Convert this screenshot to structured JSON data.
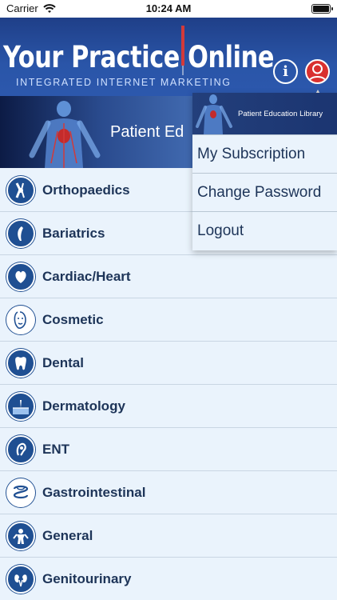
{
  "status_bar": {
    "carrier": "Carrier",
    "time": "10:24 AM"
  },
  "header": {
    "logo_title": "Your Practice Online",
    "logo_subtitle": "INTEGRATED INTERNET MARKETING",
    "info_icon": "info-icon",
    "user_icon": "user-icon"
  },
  "banner": {
    "label": "Patient Ed"
  },
  "menu": {
    "banner_label": "Patient Education Library",
    "items": [
      {
        "label": "My Subscription"
      },
      {
        "label": "Change Password"
      },
      {
        "label": "Logout"
      }
    ]
  },
  "categories": [
    {
      "label": "Orthopaedics",
      "icon": "knee-joint-icon"
    },
    {
      "label": "Bariatrics",
      "icon": "stomach-icon"
    },
    {
      "label": "Cardiac/Heart",
      "icon": "heart-icon"
    },
    {
      "label": "Cosmetic",
      "icon": "face-icon"
    },
    {
      "label": "Dental",
      "icon": "tooth-icon"
    },
    {
      "label": "Dermatology",
      "icon": "skin-icon"
    },
    {
      "label": "ENT",
      "icon": "ear-icon"
    },
    {
      "label": "Gastrointestinal",
      "icon": "intestine-icon"
    },
    {
      "label": "General",
      "icon": "body-icon"
    },
    {
      "label": "Genitourinary",
      "icon": "kidney-icon"
    }
  ],
  "colors": {
    "header_blue": "#2a55a8",
    "accent_red": "#d9302f",
    "list_bg": "#eaf3fc",
    "text_dark": "#1d3458"
  }
}
